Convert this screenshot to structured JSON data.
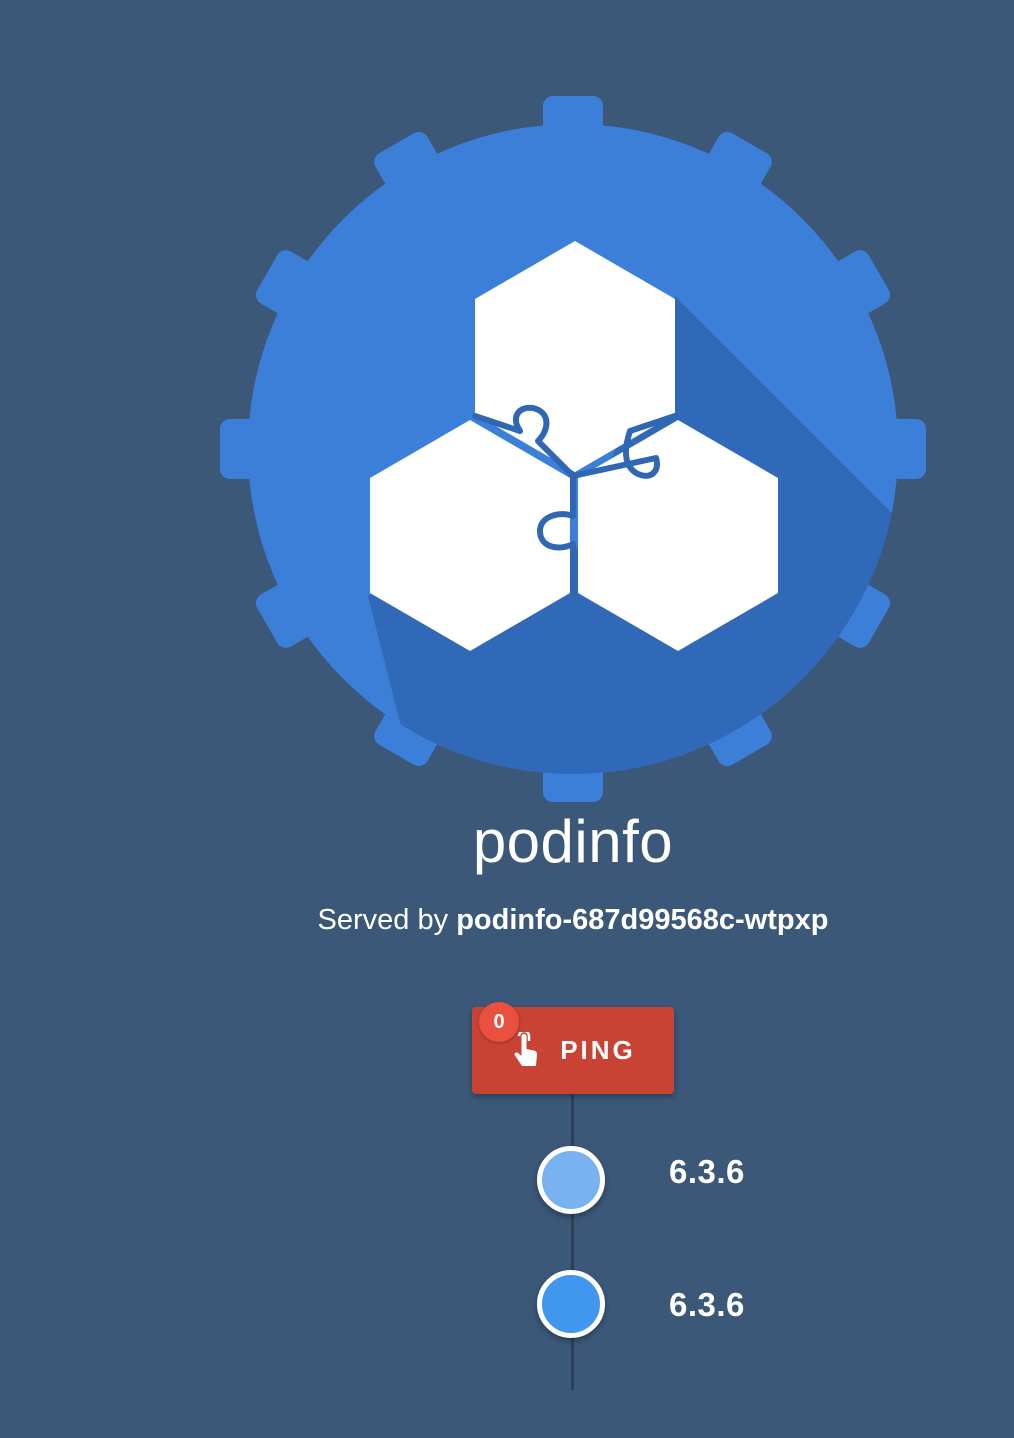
{
  "app": {
    "title": "podinfo",
    "served_by_prefix": "Served by",
    "pod_name": "podinfo-687d99568c-wtpxp"
  },
  "ping": {
    "label": "PING",
    "count": "0",
    "icon": "touch-app-icon"
  },
  "versions": [
    {
      "label": "6.3.6",
      "color": "#78b2f1"
    },
    {
      "label": "6.3.6",
      "color": "#4197ee"
    }
  ],
  "colors": {
    "background": "#3b5878",
    "gear": "#3c7fd9",
    "button": "#c84333",
    "badge": "#e9503f"
  }
}
